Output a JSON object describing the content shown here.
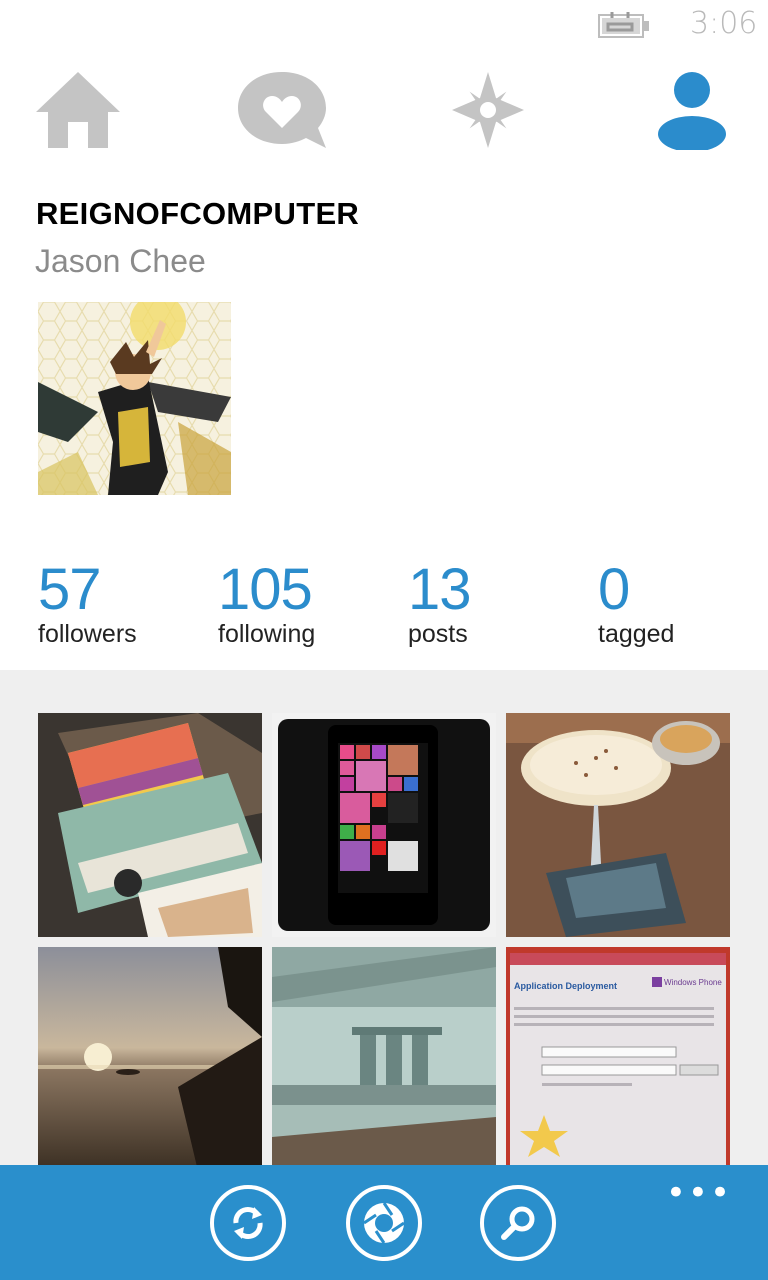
{
  "status": {
    "time": "3:06",
    "battery_icon": "battery-charging-icon"
  },
  "nav": {
    "items": [
      {
        "name": "home-icon",
        "active": false
      },
      {
        "name": "news-heart-icon",
        "active": false
      },
      {
        "name": "explore-star-icon",
        "active": false
      },
      {
        "name": "profile-icon",
        "active": true
      }
    ],
    "active_color": "#2b8ccc",
    "inactive_color": "#c4c4c4"
  },
  "profile": {
    "username": "REIGNOFCOMPUTER",
    "full_name": "Jason Chee"
  },
  "stats": [
    {
      "value": "57",
      "label": "followers"
    },
    {
      "value": "105",
      "label": "following"
    },
    {
      "value": "13",
      "label": "posts"
    },
    {
      "value": "0",
      "label": "tagged"
    }
  ],
  "photos": [
    "polaroid-camera-photo",
    "windows-phone-photo",
    "cocktail-photo",
    "sunset-beach-photo",
    "marina-bay-sands-photo",
    "application-deployment-screen-photo"
  ],
  "appbar": {
    "buttons": [
      "refresh-icon",
      "camera-shutter-icon",
      "search-icon"
    ],
    "more": "•••",
    "color": "#2a8fcc"
  }
}
